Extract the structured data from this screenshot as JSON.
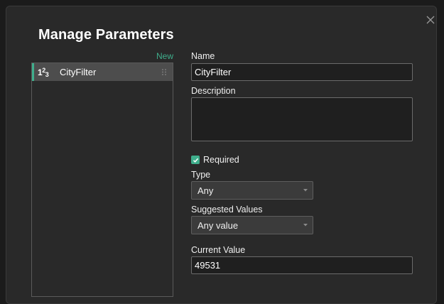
{
  "dialog": {
    "title": "Manage Parameters",
    "new_label": "New"
  },
  "parameters": [
    {
      "type_icon": "123-number-icon",
      "name": "CityFilter",
      "selected": true
    }
  ],
  "form": {
    "name_label": "Name",
    "name_value": "CityFilter",
    "description_label": "Description",
    "description_value": "",
    "required_label": "Required",
    "required_checked": true,
    "type_label": "Type",
    "type_value": "Any",
    "suggested_label": "Suggested Values",
    "suggested_value": "Any value",
    "current_label": "Current Value",
    "current_value": "49531"
  },
  "colors": {
    "accent": "#3fae8c",
    "background": "#292929",
    "selected_item": "#4d4d4d"
  }
}
